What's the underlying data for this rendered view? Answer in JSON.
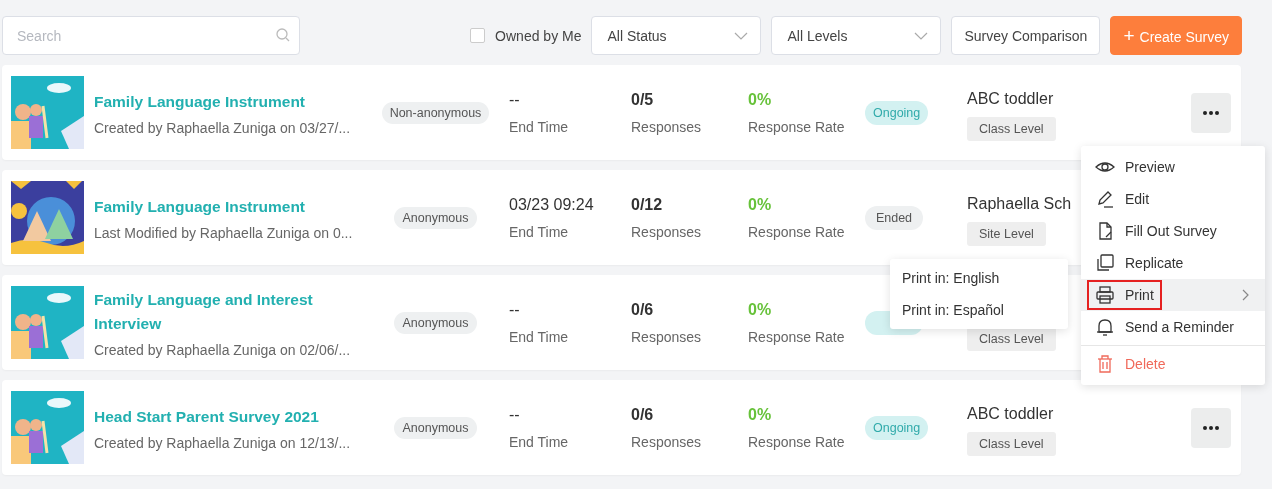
{
  "toolbar": {
    "search": {
      "placeholder": "Search"
    },
    "owned_by_me": {
      "label": "Owned by Me",
      "checked": false
    },
    "filters": [
      {
        "value": "All Status"
      },
      {
        "value": "All Levels"
      }
    ],
    "buttons": [
      {
        "label": "Survey Comparison",
        "kind": "plain"
      },
      {
        "label": "Create Survey",
        "kind": "primary",
        "icon": "+"
      }
    ]
  },
  "surveys": [
    {
      "title": "Family Language Instrument",
      "subtitle": "Created by Raphaella Zuniga on 03/27/...",
      "anonymity": "Non-anonymous",
      "end_time": "--",
      "end_time_label": "End Time",
      "responses": "0/5",
      "responses_label": "Responses",
      "rate": "0%",
      "rate_label": "Response Rate",
      "status": {
        "kind": "ongoing",
        "label": "Ongoing"
      },
      "org": "ABC toddler",
      "level": "Class Level",
      "more_button": true
    },
    {
      "title": "Family Language Instrument",
      "subtitle": "Last Modified by Raphaella Zuniga on 0...",
      "anonymity": "Anonymous",
      "end_time": "03/23 09:24",
      "end_time_label": "End Time",
      "responses": "0/12",
      "responses_label": "Responses",
      "rate": "0%",
      "rate_label": "Response Rate",
      "status": {
        "kind": "ended",
        "label": "Ended"
      },
      "org": "Raphaella Sch",
      "level": "Site Level"
    },
    {
      "title": "Family Language and Interest Interview",
      "subtitle": "Created by Raphaella Zuniga on 02/06/...",
      "anonymity": "Anonymous",
      "end_time": "--",
      "end_time_label": "End Time",
      "responses": "0/6",
      "responses_label": "Responses",
      "rate": "0%",
      "rate_label": "Response Rate",
      "status": {
        "kind": "ongoing"
      },
      "level": "Class Level"
    },
    {
      "title": "Head Start Parent Survey 2021",
      "subtitle": "Created by Raphaella Zuniga on 12/13/...",
      "anonymity": "Anonymous",
      "end_time": "--",
      "end_time_label": "End Time",
      "responses": "0/6",
      "responses_label": "Responses",
      "rate": "0%",
      "rate_label": "Response Rate",
      "status": {
        "kind": "ongoing",
        "label": "Ongoing"
      },
      "org": "ABC toddler",
      "level": "Class Level",
      "more_button": true
    }
  ],
  "action_menu": {
    "items": [
      {
        "label": "Preview",
        "kind": "normal",
        "selected": false,
        "has_submenu": false,
        "highlighted": false
      },
      {
        "label": "Edit",
        "kind": "normal",
        "selected": false,
        "has_submenu": false,
        "highlighted": false
      },
      {
        "label": "Fill Out Survey",
        "kind": "normal",
        "selected": false,
        "has_submenu": false,
        "highlighted": false
      },
      {
        "label": "Replicate",
        "kind": "normal",
        "selected": false,
        "has_submenu": false,
        "highlighted": false
      },
      {
        "label": "Print",
        "kind": "normal",
        "selected": true,
        "has_submenu": true,
        "highlighted": true
      },
      {
        "label": "Send a Reminder",
        "kind": "normal",
        "selected": false,
        "has_submenu": false,
        "highlighted": false
      },
      {
        "label": "Delete",
        "kind": "danger",
        "selected": false,
        "has_submenu": false,
        "highlighted": false
      }
    ],
    "submenu": [
      {
        "label": "Print in: English"
      },
      {
        "label": "Print in: Español"
      }
    ]
  }
}
